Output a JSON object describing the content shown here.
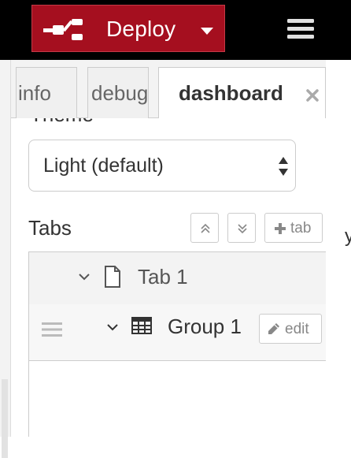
{
  "header": {
    "deploy_label": "Deploy",
    "icons": {
      "deploy": "deploy-icon",
      "dropdown": "chevron-down-icon",
      "menu": "hamburger-menu-icon"
    },
    "colors": {
      "topbar_bg": "#000000",
      "deploy_bg": "#a50f1f",
      "deploy_text": "#ffffff"
    }
  },
  "sidebar": {
    "tabs": [
      {
        "label": "info",
        "active": false
      },
      {
        "label": "debug",
        "active": false
      },
      {
        "label": "dashboard",
        "active": true
      }
    ],
    "close_icon": "close-icon"
  },
  "dashboard": {
    "theme_heading": "Theme",
    "theme_value": "Light (default)",
    "tabs_heading": "Tabs",
    "add_tab_label": "tab",
    "tree": {
      "tab_label": "Tab 1",
      "group_label": "Group 1",
      "edit_label": "edit"
    }
  },
  "page": {
    "stray_text": "y"
  }
}
